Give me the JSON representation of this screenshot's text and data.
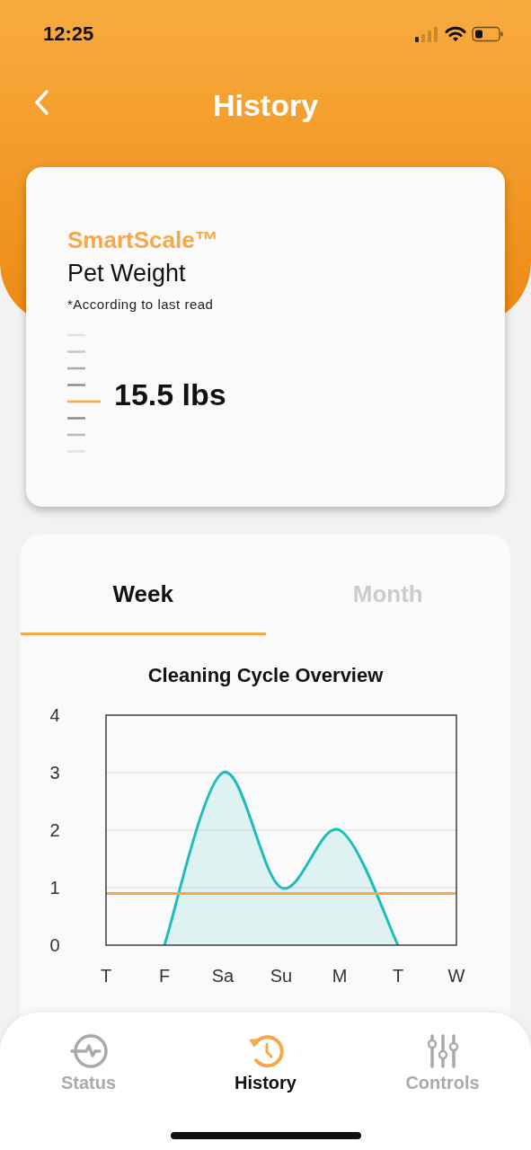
{
  "status_bar": {
    "time": "12:25"
  },
  "header": {
    "title": "History"
  },
  "weight_card": {
    "brand": "SmartScale™",
    "title": "Pet Weight",
    "note": "*According to last read",
    "reading": "15.5 lbs"
  },
  "tabs": [
    {
      "label": "Week",
      "selected": true
    },
    {
      "label": "Month",
      "selected": false
    }
  ],
  "chart": {
    "chart_data": {
      "type": "area",
      "title": "Cleaning Cycle Overview",
      "categories": [
        "T",
        "F",
        "Sa",
        "Su",
        "M",
        "T",
        "W"
      ],
      "series": [
        {
          "color": "#1fbcbc",
          "values": [
            null,
            0,
            3,
            1,
            2,
            0,
            null
          ]
        },
        {
          "type": "line",
          "color": "#f7a84a",
          "values": [
            0.9,
            0.9,
            0.9,
            0.9,
            0.9,
            0.9,
            0.9
          ]
        }
      ],
      "ylim": [
        0,
        4
      ],
      "yticks": [
        0,
        1,
        2,
        3,
        4
      ],
      "grid": true
    }
  },
  "nav": [
    {
      "label": "Status",
      "kind": "pulse",
      "selected": false
    },
    {
      "label": "History",
      "kind": "history",
      "selected": true
    },
    {
      "label": "Controls",
      "kind": "sliders",
      "selected": false
    }
  ]
}
